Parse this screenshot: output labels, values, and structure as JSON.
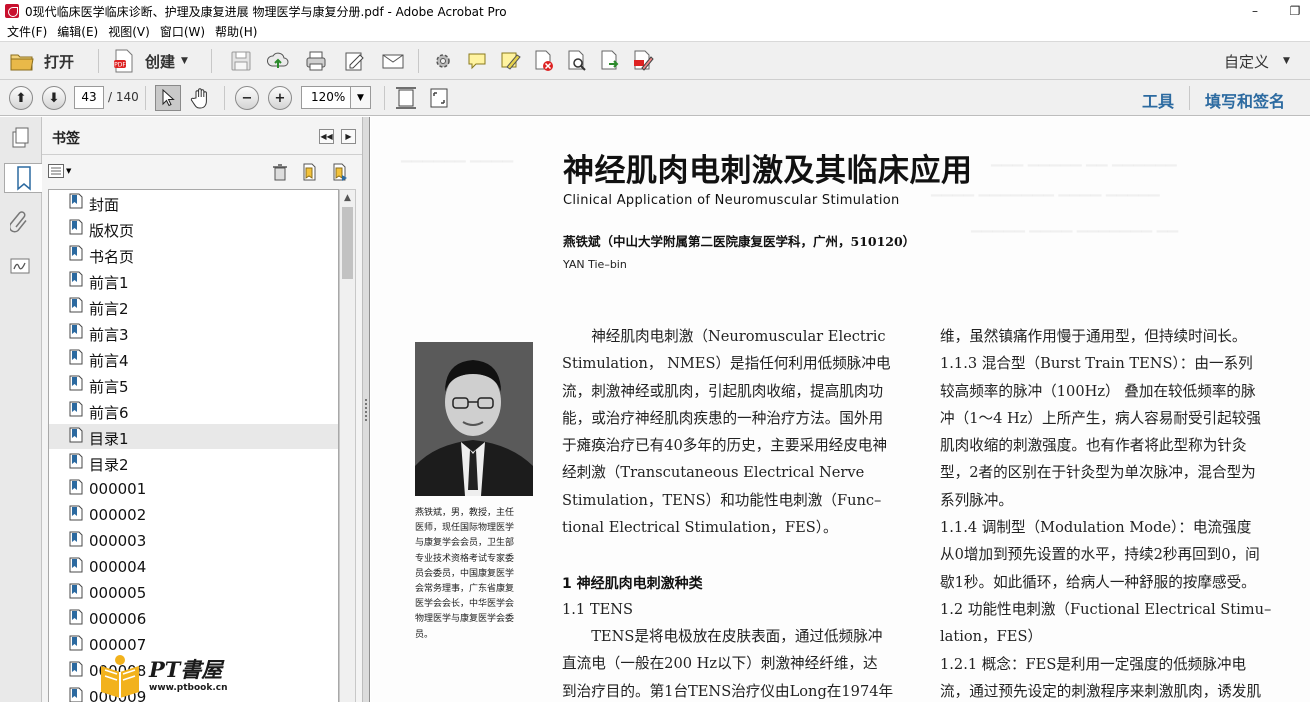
{
  "window": {
    "title": "0现代临床医学临床诊断、护理及康复进展 物理医学与康复分册.pdf - Adobe Acrobat Pro",
    "minimize": "–",
    "restore": "❐"
  },
  "menu": [
    "文件(F)",
    "编辑(E)",
    "视图(V)",
    "窗口(W)",
    "帮助(H)"
  ],
  "toolbar": {
    "open_label": "打开",
    "create_label": "创建",
    "customize_label": "自定义"
  },
  "navbar": {
    "page_current": "43",
    "page_total": "/ 140",
    "zoom": "120%",
    "tools_label": "工具",
    "fill_sign_label": "填写和签名"
  },
  "bookmarks": {
    "title": "书签",
    "selected_index": 9,
    "items": [
      "封面",
      "版权页",
      "书名页",
      "前言1",
      "前言2",
      "前言3",
      "前言4",
      "前言5",
      "前言6",
      "目录1",
      "目录2",
      "000001",
      "000002",
      "000003",
      "000004",
      "000005",
      "000006",
      "000007",
      "000008",
      "000009"
    ]
  },
  "document": {
    "title": "神经肌肉电刺激及其临床应用",
    "subtitle": "Clinical Application of Neuromuscular Stimulation",
    "author": "燕铁斌（中山大学附属第二医院康复医学科，广州，510120）",
    "author_en": "YAN Tie–bin",
    "bio": [
      "燕铁斌，男，教授，主任",
      "医师，现任国际物理医学",
      "与康复学会会员，卫生部",
      "专业技术资格考试专家委",
      "员会委员，中国康复医学",
      "会常务理事，广东省康复",
      "医学会会长，中华医学会",
      "物理医学与康复医学会委",
      "员。"
    ],
    "col1": [
      "　　神经肌肉电刺激（Neuromuscular Electric",
      "Stimulation， NMES）是指任何利用低频脉冲电",
      "流，刺激神经或肌肉，引起肌肉收缩，提高肌肉功",
      "能，或治疗神经肌肉疾患的一种治疗方法。国外用",
      "于瘫痪治疗已有40多年的历史，主要采用经皮电神",
      "经刺激（Transcutaneous Electrical Nerve",
      "Stimulation，TENS）和功能性电刺激（Func–",
      "tional Electrical Stimulation，FES）。"
    ],
    "section1_heading": "1  神经肌肉电刺激种类",
    "section1_1": "1.1  TENS",
    "col1b": [
      "　　TENS是将电极放在皮肤表面，通过低频脉冲",
      "直流电（一般在200 Hz以下）刺激神经纤维，达",
      "到治疗目的。第1台TENS治疗仪由Long在1974年"
    ],
    "col2": [
      "维，虽然镇痛作用慢于通用型，但持续时间长。",
      "1.1.3  混合型（Burst Train TENS）：由一系列",
      "较高频率的脉冲（100Hz）  叠加在较低频率的脉",
      "冲（1～4 Hz）上所产生，病人容易耐受引起较强",
      "肌肉收缩的刺激强度。也有作者将此型称为针灸",
      "型，2者的区别在于针灸型为单次脉冲，混合型为",
      "系列脉冲。",
      "1.1.4  调制型（Modulation Mode）：电流强度",
      "从0增加到预先设置的水平，持续2秒再回到0，间",
      "歇1秒。如此循环，给病人一种舒服的按摩感受。",
      "1.2  功能性电刺激（Fuctional Electrical Stimu–",
      "lation，FES）",
      "1.2.1  概念：FES是利用一定强度的低频脉冲电",
      "流，通过预先设定的刺激程序来刺激肌肉，诱发肌"
    ]
  },
  "watermark": {
    "brand": "PT書屋",
    "url": "www.ptbook.cn"
  }
}
